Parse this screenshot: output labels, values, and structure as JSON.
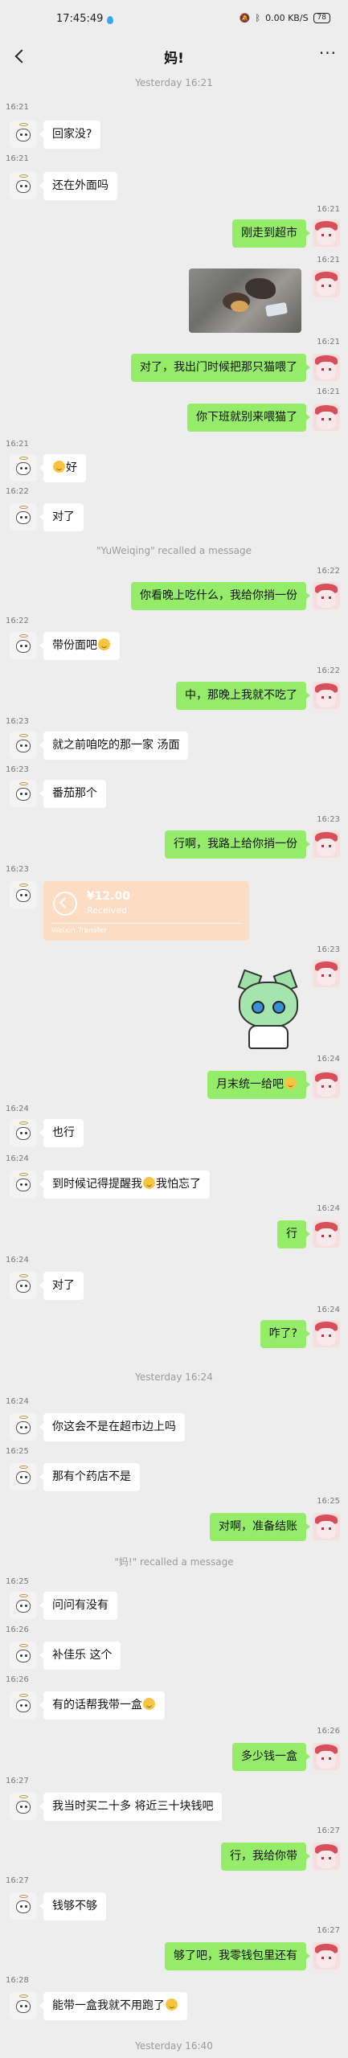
{
  "status_bar": {
    "time": "17:45:49",
    "net_speed": "0.00 KB/S",
    "battery": "78"
  },
  "header": {
    "title": "妈!"
  },
  "separators": {
    "s1": "Yesterday 16:21",
    "recall_me": "\"YuWeiqing\" recalled a message",
    "s2": "Yesterday 16:24",
    "recall_mom": "\"妈!\" recalled a message",
    "s3": "Yesterday 16:40"
  },
  "transfer": {
    "amount": "¥12.00",
    "status": "Received",
    "label": "Weixin Transfer"
  },
  "messages": [
    {
      "time": "16:21",
      "text": "回家没?"
    },
    {
      "time": "16:21",
      "text": "还在外面吗"
    },
    {
      "time": "16:21",
      "text": "刚走到超市"
    },
    {
      "time": "16:21"
    },
    {
      "time": "16:21",
      "text": "对了，我出门时候把那只猫喂了"
    },
    {
      "time": "16:21",
      "text": "你下班就别来喂猫了"
    },
    {
      "time": "16:21",
      "text": "好"
    },
    {
      "time": "16:22",
      "text": "对了"
    },
    {
      "time": "16:22",
      "text": "你看晚上吃什么，我给你捎一份"
    },
    {
      "time": "16:22",
      "text": "带份面吧"
    },
    {
      "time": "16:22",
      "text": "中，那晚上我就不吃了"
    },
    {
      "time": "16:23",
      "text": "就之前咱吃的那一家 汤面"
    },
    {
      "time": "16:23",
      "text": "番茄那个"
    },
    {
      "time": "16:23",
      "text": "行啊，我路上给你捎一份"
    },
    {
      "time": "16:23"
    },
    {
      "time": "16:23"
    },
    {
      "time": "16:24",
      "text": "月末统一给吧"
    },
    {
      "time": "16:24",
      "text": "也行"
    },
    {
      "time": "16:24",
      "text_a": "到时候记得提醒我",
      "text_b": "我怕忘了"
    },
    {
      "time": "16:24",
      "text": "行"
    },
    {
      "time": "16:24",
      "text": "对了"
    },
    {
      "time": "16:24",
      "text": "咋了?"
    },
    {
      "time": "16:24",
      "text": "你这会不是在超市边上吗"
    },
    {
      "time": "16:25",
      "text": "那有个药店不是"
    },
    {
      "time": "16:25",
      "text": "对啊，准备结账"
    },
    {
      "time": "16:25",
      "text": "问问有没有"
    },
    {
      "time": "16:26",
      "text": "补佳乐 这个"
    },
    {
      "time": "16:26",
      "text": "有的话帮我带一盒"
    },
    {
      "time": "16:26",
      "text": "多少钱一盒"
    },
    {
      "time": "16:27",
      "text": "我当时买二十多 将近三十块钱吧"
    },
    {
      "time": "16:27",
      "text": "行，我给你带"
    },
    {
      "time": "16:27",
      "text": "钱够不够"
    },
    {
      "time": "16:27",
      "text": "够了吧，我零钱包里还有"
    },
    {
      "time": "16:28",
      "text": "能带一盒我就不用跑了"
    }
  ]
}
